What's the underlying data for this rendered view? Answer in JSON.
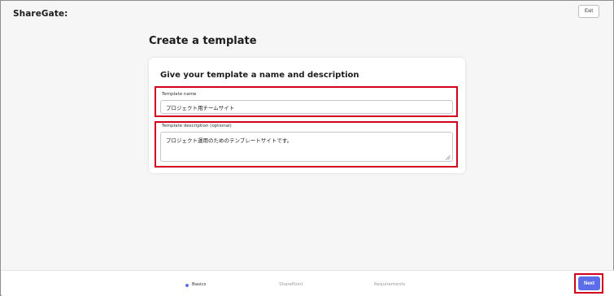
{
  "header": {
    "logo_text": "ShareGate:",
    "exit_label": "Exit"
  },
  "page": {
    "title": "Create a template"
  },
  "card": {
    "heading": "Give your template a name and description",
    "name_label": "Template name",
    "name_value": "プロジェクト用チームサイト",
    "description_label": "Template description (optional)",
    "description_value": "プロジェクト運用のためのテンプレートサイトです。"
  },
  "footer": {
    "steps": [
      "Basics",
      "SharePoint",
      "Requirements"
    ],
    "next_label": "Next"
  },
  "colors": {
    "accent": "#5b6de8",
    "highlight": "#d0021b"
  }
}
